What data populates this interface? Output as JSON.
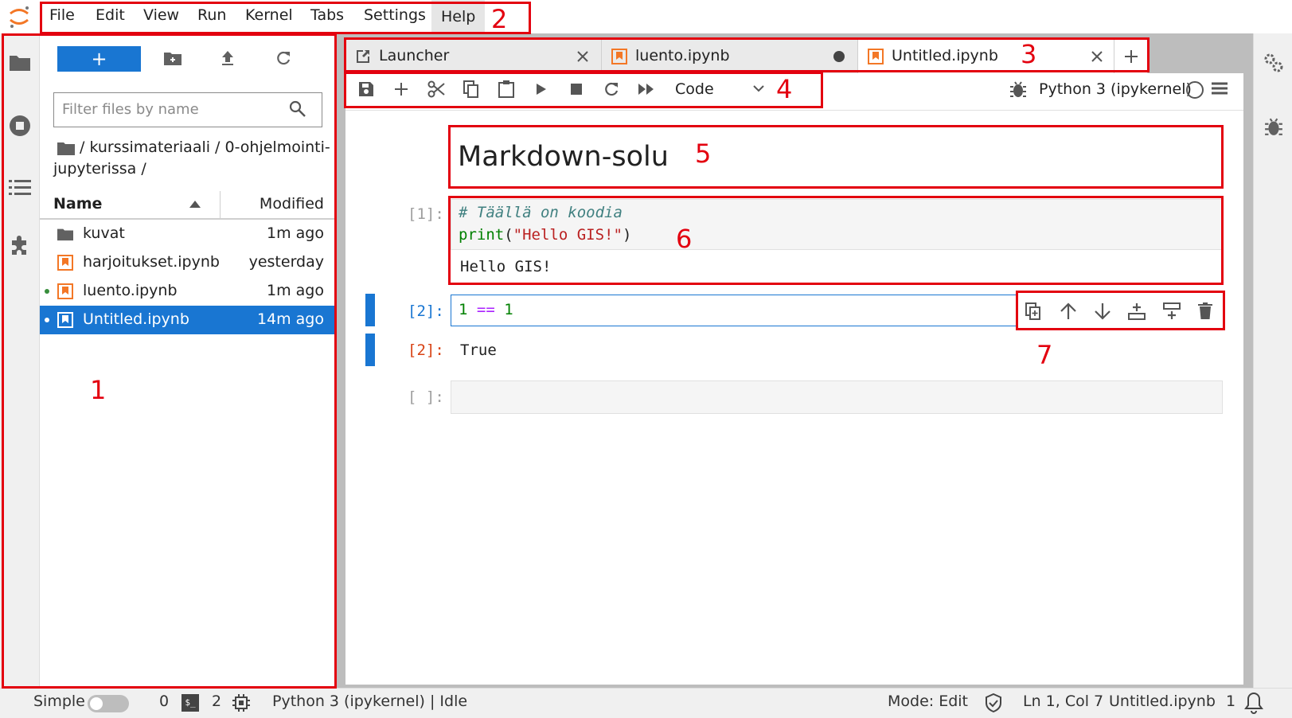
{
  "menu": {
    "items": [
      "File",
      "Edit",
      "View",
      "Run",
      "Kernel",
      "Tabs",
      "Settings",
      "Help"
    ]
  },
  "filebrowser": {
    "new_label": "+",
    "filter_placeholder": "Filter files by name",
    "breadcrumb_line1": "/ kurssimateriaali / 0-ohjelmointi-",
    "breadcrumb_line2": "jupyterissa /",
    "col_name": "Name",
    "col_modified": "Modified",
    "files": [
      {
        "name": "kuvat",
        "modified": "1m ago",
        "type": "folder",
        "running": false
      },
      {
        "name": "harjoitukset.ipynb",
        "modified": "yesterday",
        "type": "notebook",
        "running": false
      },
      {
        "name": "luento.ipynb",
        "modified": "1m ago",
        "type": "notebook",
        "running": true
      },
      {
        "name": "Untitled.ipynb",
        "modified": "14m ago",
        "type": "notebook",
        "running": true,
        "selected": true
      }
    ]
  },
  "tabs": [
    {
      "label": "Launcher"
    },
    {
      "label": "luento.ipynb"
    },
    {
      "label": "Untitled.ipynb"
    }
  ],
  "toolbar": {
    "cell_type": "Code",
    "kernel": "Python 3 (ipykernel)"
  },
  "cells": {
    "markdown": "Markdown-solu",
    "c1_prompt": "[1]:",
    "c1_comment": "# Täällä on koodia",
    "c1_print": "print",
    "c1_open": "(",
    "c1_str": "\"Hello GIS!\"",
    "c1_close": ")",
    "c1_output": "Hello GIS!",
    "c2_prompt": "[2]:",
    "c2_left": "1",
    "c2_op": "==",
    "c2_right": "1",
    "c2_out_prompt": "[2]:",
    "c2_output": "True",
    "c3_prompt": "[ ]:"
  },
  "annotations": [
    "1",
    "2",
    "3",
    "4",
    "5",
    "6",
    "7"
  ],
  "statusbar": {
    "mode_label": "Simple",
    "terminals": "0",
    "kernels": "2",
    "kernel_status": "Python 3 (ipykernel) | Idle",
    "mode": "Mode: Edit",
    "cursor": "Ln 1, Col 7",
    "file": "Untitled.ipynb",
    "notifications": "1"
  },
  "colors": {
    "accent": "#1976d2",
    "annotation": "#e3000f",
    "notebook_icon": "#f37726"
  }
}
